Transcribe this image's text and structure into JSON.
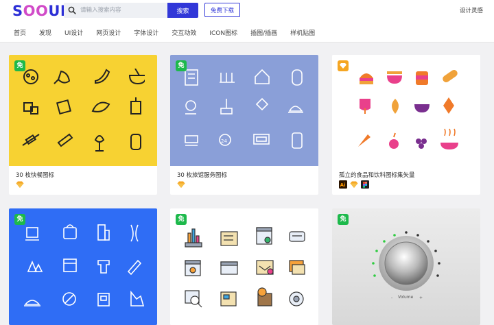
{
  "header": {
    "logo": {
      "s": "S",
      "oo": "OO",
      "ui": "UI"
    },
    "search_placeholder": "请输入搜索内容",
    "search_button": "搜索",
    "download_button": "免费下载",
    "user_link": "设计灵感"
  },
  "nav": [
    "首页",
    "发现",
    "UI设计",
    "网页设计",
    "字体设计",
    "交互动效",
    "ICON图标",
    "插图/插画",
    "样机贴图"
  ],
  "cards": [
    {
      "title": "30 枚快餐图标",
      "badge": "免",
      "bg": "#f7d232",
      "tags": [
        "sketch"
      ]
    },
    {
      "title": "30 枚旅馆服务图标",
      "badge": "免",
      "bg": "#8a9fd8",
      "tags": [
        "sketch"
      ]
    },
    {
      "title": "孤立的食品和饮料图标集矢量",
      "badge": "",
      "bg": "#ffffff",
      "tags": [
        "ai",
        "sketch",
        "figma"
      ]
    },
    {
      "title": "",
      "badge": "免",
      "bg": "#2f6df5",
      "tags": []
    },
    {
      "title": "",
      "badge": "免",
      "bg": "#ffffff",
      "tags": []
    },
    {
      "title": "",
      "badge": "免",
      "bg": "#e2e2e2",
      "tags": [],
      "knob_label": "Volume"
    }
  ],
  "colors": {
    "brand": "#3137d8",
    "free": "#1db94b",
    "sketch": "#f5a623"
  }
}
